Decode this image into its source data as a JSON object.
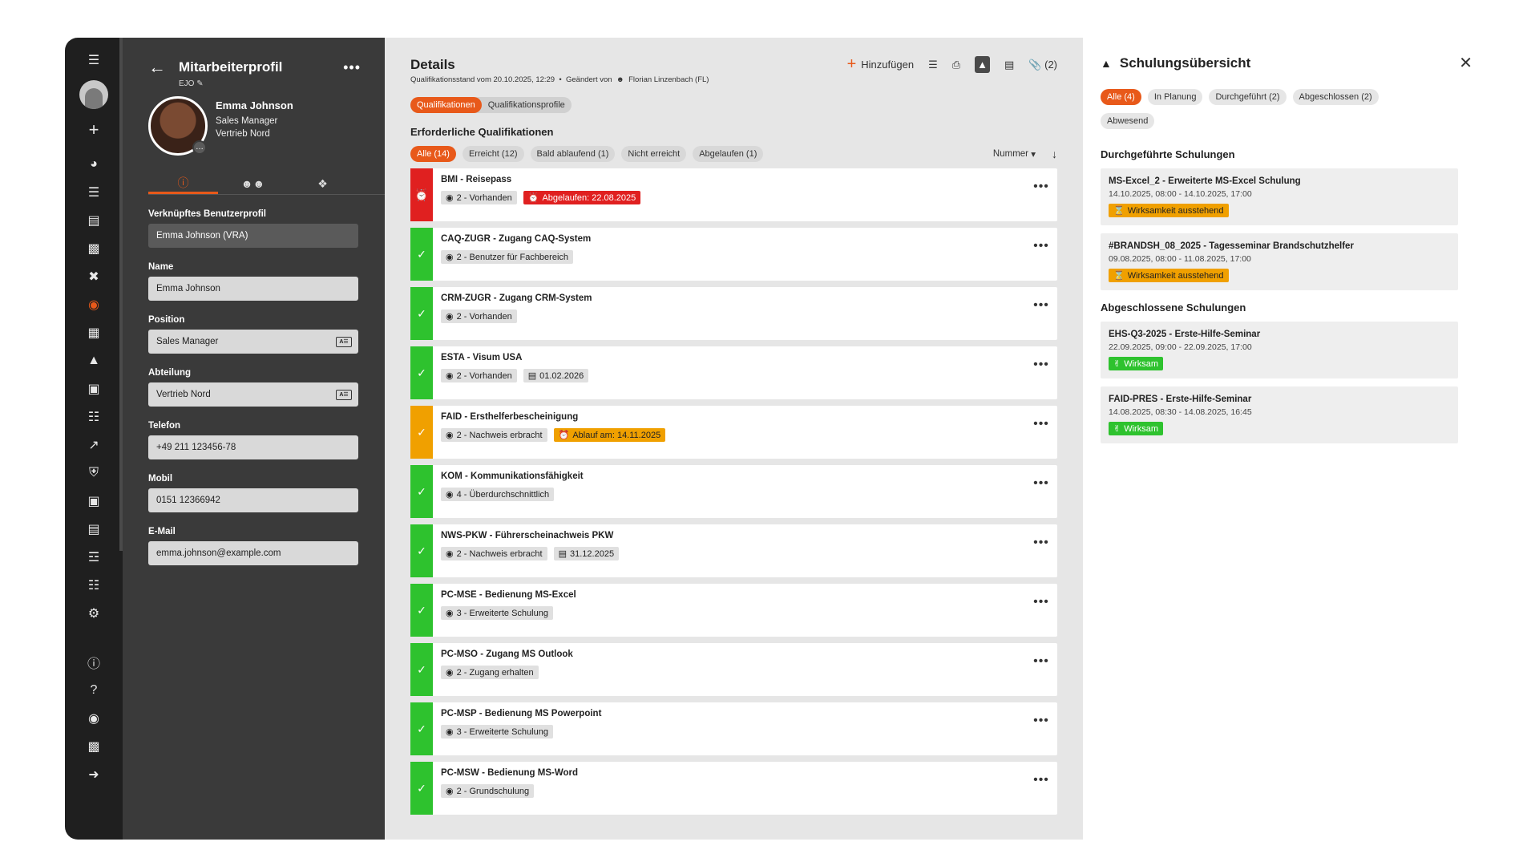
{
  "profile": {
    "title": "Mitarbeiterprofil",
    "sub": "EJO",
    "name": "Emma Johnson",
    "role": "Sales Manager",
    "department": "Vertrieb Nord",
    "fields": [
      {
        "label": "Verknüpftes Benutzerprofil",
        "value": "Emma Johnson (VRA)"
      },
      {
        "label": "Name",
        "value": "Emma Johnson"
      },
      {
        "label": "Position",
        "value": "Sales Manager"
      },
      {
        "label": "Abteilung",
        "value": "Vertrieb Nord"
      },
      {
        "label": "Telefon",
        "value": "+49 211 123456-78"
      },
      {
        "label": "Mobil",
        "value": "0151 12366942"
      },
      {
        "label": "E-Mail",
        "value": "emma.johnson@example.com"
      }
    ]
  },
  "details": {
    "title": "Details",
    "add_label": "Hinzufügen",
    "attach_count": "(2)",
    "meta_status": "Qualifikationsstand vom 20.10.2025, 12:29",
    "meta_changed": "Geändert von",
    "meta_user": "Florian Linzenbach (FL)",
    "tabs": [
      "Qualifikationen",
      "Qualifikationsprofile"
    ],
    "section": "Erforderliche Qualifikationen",
    "filters": [
      "Alle (14)",
      "Erreicht (12)",
      "Bald ablaufend (1)",
      "Nicht erreicht",
      "Abgelaufen (1)"
    ],
    "sort_label": "Nummer",
    "qualifications": [
      {
        "title": "BMI - Reisepass",
        "status": "red",
        "level": "2 - Vorhanden",
        "extra": "Abgelaufen: 22.08.2025",
        "extra_type": "red"
      },
      {
        "title": "CAQ-ZUGR - Zugang CAQ-System",
        "status": "green",
        "level": "2 - Benutzer für Fachbereich",
        "extra": "",
        "extra_type": ""
      },
      {
        "title": "CRM-ZUGR - Zugang CRM-System",
        "status": "green",
        "level": "2 - Vorhanden",
        "extra": "",
        "extra_type": ""
      },
      {
        "title": "ESTA - Visum USA",
        "status": "green",
        "level": "2 - Vorhanden",
        "extra": "01.02.2026",
        "extra_type": "date"
      },
      {
        "title": "FAID - Ersthelferbescheinigung",
        "status": "orange",
        "level": "2 - Nachweis erbracht",
        "extra": "Ablauf am: 14.11.2025",
        "extra_type": "orange"
      },
      {
        "title": "KOM - Kommunikationsfähigkeit",
        "status": "green",
        "level": "4 - Überdurchschnittlich",
        "extra": "",
        "extra_type": ""
      },
      {
        "title": "NWS-PKW - Führerscheinachweis PKW",
        "status": "green",
        "level": "2 - Nachweis erbracht",
        "extra": "31.12.2025",
        "extra_type": "date"
      },
      {
        "title": "PC-MSE - Bedienung MS-Excel",
        "status": "green",
        "level": "3 - Erweiterte Schulung",
        "extra": "",
        "extra_type": ""
      },
      {
        "title": "PC-MSO - Zugang MS Outlook",
        "status": "green",
        "level": "2 - Zugang erhalten",
        "extra": "",
        "extra_type": ""
      },
      {
        "title": "PC-MSP - Bedienung MS Powerpoint",
        "status": "green",
        "level": "3 - Erweiterte Schulung",
        "extra": "",
        "extra_type": ""
      },
      {
        "title": "PC-MSW - Bedienung MS-Word",
        "status": "green",
        "level": "2 - Grundschulung",
        "extra": "",
        "extra_type": ""
      }
    ]
  },
  "training": {
    "title": "Schulungsübersicht",
    "filters": [
      "Alle (4)",
      "In Planung",
      "Durchgeführt (2)",
      "Abgeschlossen (2)",
      "Abwesend"
    ],
    "done_section": "Durchgeführte Schulungen",
    "done": [
      {
        "title": "MS-Excel_2 - Erweiterte MS-Excel Schulung",
        "dates": "14.10.2025, 08:00 - 14.10.2025, 17:00",
        "badge": "Wirksamkeit ausstehend",
        "badge_type": "orange"
      },
      {
        "title": "#BRANDSH_08_2025 - Tagesseminar Brandschutzhelfer",
        "dates": "09.08.2025, 08:00 - 11.08.2025, 17:00",
        "badge": "Wirksamkeit ausstehend",
        "badge_type": "orange"
      }
    ],
    "closed_section": "Abgeschlossene Schulungen",
    "closed": [
      {
        "title": "EHS-Q3-2025 - Erste-Hilfe-Seminar",
        "dates": "22.09.2025, 09:00 - 22.09.2025, 17:00",
        "badge": "Wirksam",
        "badge_type": "green"
      },
      {
        "title": "FAID-PRES - Erste-Hilfe-Seminar",
        "dates": "14.08.2025, 08:30 - 14.08.2025, 16:45",
        "badge": "Wirksam",
        "badge_type": "green"
      }
    ]
  }
}
